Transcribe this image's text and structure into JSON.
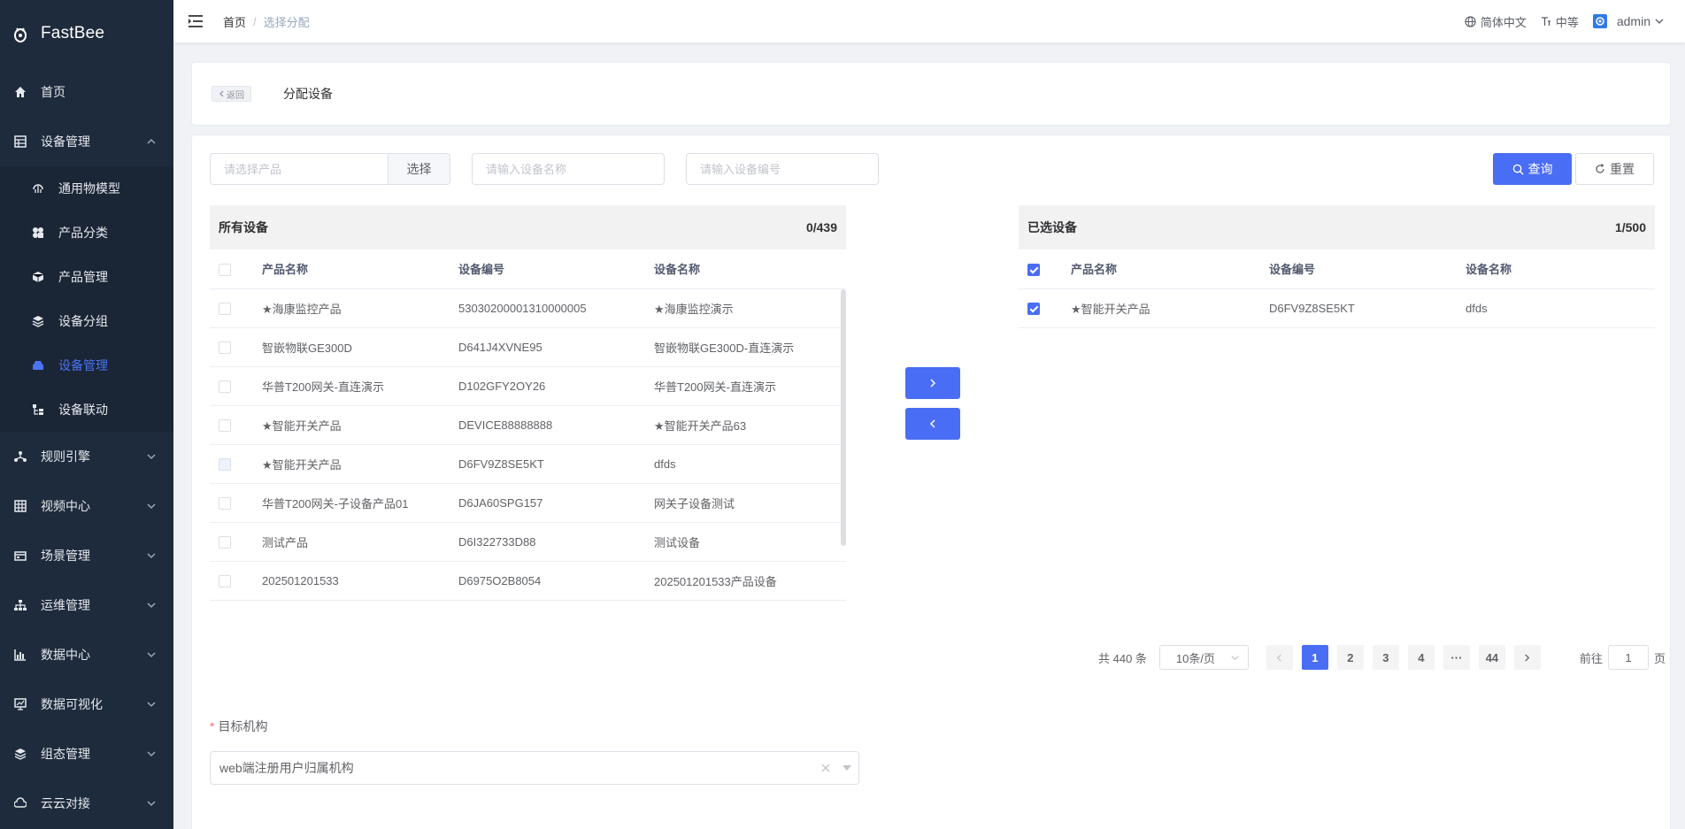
{
  "app": {
    "name": "FastBee"
  },
  "sidebar": {
    "items": [
      {
        "label": "首页",
        "icon": "home-icon"
      },
      {
        "label": "设备管理",
        "icon": "device-manage-icon",
        "expanded": true,
        "children": [
          {
            "label": "通用物模型",
            "icon": "model-icon"
          },
          {
            "label": "产品分类",
            "icon": "category-icon"
          },
          {
            "label": "产品管理",
            "icon": "cube-icon"
          },
          {
            "label": "设备分组",
            "icon": "layers-icon"
          },
          {
            "label": "设备管理",
            "icon": "device-icon",
            "active": true
          },
          {
            "label": "设备联动",
            "icon": "link-icon"
          }
        ]
      },
      {
        "label": "规则引擎",
        "icon": "rule-icon"
      },
      {
        "label": "视频中心",
        "icon": "video-icon"
      },
      {
        "label": "场景管理",
        "icon": "scene-icon"
      },
      {
        "label": "运维管理",
        "icon": "ops-icon"
      },
      {
        "label": "数据中心",
        "icon": "chart-icon"
      },
      {
        "label": "数据可视化",
        "icon": "monitor-icon"
      },
      {
        "label": "组态管理",
        "icon": "layers-icon"
      },
      {
        "label": "云云对接",
        "icon": "cloud-icon"
      }
    ]
  },
  "header": {
    "breadcrumb_home": "首页",
    "breadcrumb_sep": "/",
    "breadcrumb_current": "选择分配",
    "language": "简体中文",
    "size": "中等",
    "user": "admin"
  },
  "page": {
    "back_label": "返回",
    "title": "分配设备"
  },
  "filters": {
    "product_placeholder": "请选择产品",
    "select_label": "选择",
    "name_placeholder": "请输入设备名称",
    "code_placeholder": "请输入设备编号",
    "query_label": "查询",
    "reset_label": "重置"
  },
  "left_table": {
    "title": "所有设备",
    "count": "0/439",
    "columns": [
      "产品名称",
      "设备编号",
      "设备名称"
    ],
    "rows": [
      {
        "product": "★海康监控产品",
        "code": "53030200001310000005",
        "name": "★海康监控演示",
        "disabled": false
      },
      {
        "product": "智嵌物联GE300D",
        "code": "D641J4XVNE95",
        "name": "智嵌物联GE300D-直连演示",
        "disabled": false
      },
      {
        "product": "华普T200网关-直连演示",
        "code": "D102GFY2OY26",
        "name": "华普T200网关-直连演示",
        "disabled": false
      },
      {
        "product": "★智能开关产品",
        "code": "DEVICE88888888",
        "name": "★智能开关产品63",
        "disabled": false
      },
      {
        "product": "★智能开关产品",
        "code": "D6FV9Z8SE5KT",
        "name": "dfds",
        "disabled": true
      },
      {
        "product": "华普T200网关-子设备产品01",
        "code": "D6JA60SPG157",
        "name": "网关子设备测试",
        "disabled": false
      },
      {
        "product": "测试产品",
        "code": "D6I322733D88",
        "name": "测试设备",
        "disabled": false
      },
      {
        "product": "202501201533",
        "code": "D6975O2B8054",
        "name": "202501201533产品设备",
        "disabled": false
      }
    ]
  },
  "right_table": {
    "title": "已选设备",
    "count": "1/500",
    "columns": [
      "产品名称",
      "设备编号",
      "设备名称"
    ],
    "rows": [
      {
        "product": "★智能开关产品",
        "code": "D6FV9Z8SE5KT",
        "name": "dfds",
        "checked": true
      }
    ]
  },
  "pagination": {
    "total": "共 440 条",
    "page_size": "10条/页",
    "pages": [
      "1",
      "2",
      "3",
      "4",
      "···",
      "44"
    ],
    "current": "1",
    "goto_label": "前往",
    "goto_value": "1",
    "page_suffix": "页"
  },
  "target_org": {
    "label": "目标机构",
    "required_mark": "*",
    "value": "web端注册用户归属机构"
  },
  "colors": {
    "sidebar_bg": "#1e2b3c",
    "accent": "#4a6df5",
    "active_menu": "#4a74f5"
  }
}
